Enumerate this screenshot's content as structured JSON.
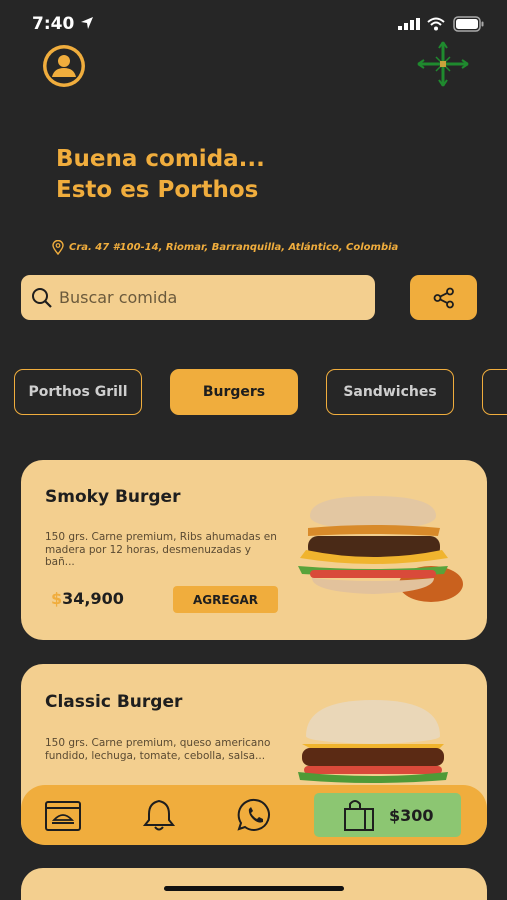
{
  "status_bar": {
    "time": "7:40"
  },
  "header": {
    "headline_line1": "Buena comida...",
    "headline_line2": "Esto es Porthos",
    "address": "Cra. 47 #100-14, Riomar, Barranquilla, Atlántico, Colombia"
  },
  "search": {
    "placeholder": "Buscar comida"
  },
  "categories": [
    {
      "label": "Porthos Grill",
      "active": false
    },
    {
      "label": "Burgers",
      "active": true
    },
    {
      "label": "Sandwiches",
      "active": false
    }
  ],
  "products": [
    {
      "name": "Smoky Burger",
      "description": "150 grs. Carne premium, Ribs ahumadas en madera por 12 horas, desmenuzadas y bañ...",
      "currency": "$",
      "price": "34,900",
      "add_label": "AGREGAR"
    },
    {
      "name": "Classic Burger",
      "description": "150 grs. Carne premium, queso americano fundido, lechuga, tomate, cebolla, salsa..."
    }
  ],
  "bottom_nav": {
    "items": [
      "menu-icon",
      "bell-icon",
      "whatsapp-icon",
      "shopping-bag-icon"
    ],
    "cart_total": "$300"
  },
  "colors": {
    "background": "#262626",
    "accent": "#f0ad3d",
    "card": "#f3cf8f",
    "cart": "#8cc672",
    "logo_green": "#1f8a2e"
  }
}
